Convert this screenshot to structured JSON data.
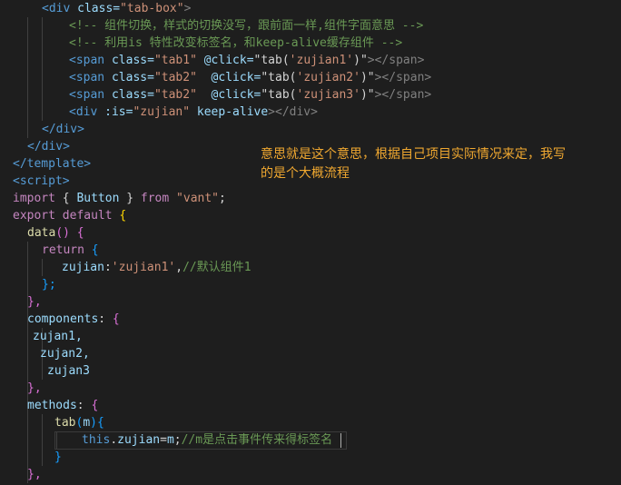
{
  "code": {
    "l1": [
      "<div ",
      "class=",
      "\"tab-box\"",
      ">"
    ],
    "l2": "<!-- 组件切换，样式的切换没写，跟前面一样,组件字面意思 -->",
    "l3": "<!-- 利用is 特性改变标签名，和keep-alive缓存组件 -->",
    "l4": [
      "<span ",
      "class=",
      "\"tab1\"",
      " @click=",
      "\"tab(",
      "'zujian1'",
      ")\"",
      "></span>"
    ],
    "l5": [
      "<span ",
      "class=",
      "\"tab2\"",
      "  @click=",
      "\"tab(",
      "'zujian2'",
      ")\"",
      "></span>"
    ],
    "l6": [
      "<span ",
      "class=",
      "\"tab2\"",
      "  @click=",
      "\"tab(",
      "'zujian3'",
      ")\"",
      "></span>"
    ],
    "l7": [
      "<div ",
      ":is=",
      "\"zujian\"",
      " keep-alive",
      "></div>"
    ],
    "l8": "</div>",
    "l9": "</div>",
    "l10": "</template>",
    "l11": "<script>",
    "l12": [
      "import",
      " { ",
      "Button",
      " } ",
      "from",
      " ",
      "\"vant\"",
      ";"
    ],
    "l13": [
      "export",
      " ",
      "default",
      " {"
    ],
    "l14": [
      "data",
      "()",
      " {"
    ],
    "l15": [
      "return",
      " {"
    ],
    "l16": [
      "zujian",
      ":",
      "'zujian1'",
      ",",
      "//默认组件1"
    ],
    "l17": "};",
    "l18": "},",
    "l19": [
      "components",
      ":",
      " {"
    ],
    "l20": "zujan1,",
    "l21": "zujan2,",
    "l22": "zujan3",
    "l23": "},",
    "l24": [
      "methods",
      ":",
      " {"
    ],
    "l25": [
      "tab",
      "(",
      "m",
      "){"
    ],
    "l26": [
      "this",
      ".",
      "zujian",
      "=",
      "m",
      ";",
      "//m是点击事件传来得标签名"
    ],
    "l27": "}",
    "l28": "},"
  },
  "annotation": {
    "line1": "意思就是这个意思，根据自己项目实际情况来定，我写",
    "line2": "的是个大概流程"
  },
  "colors": {
    "background": "#1e1e1e",
    "tag": "#569cd6",
    "attribute": "#9cdcfe",
    "string": "#ce9178",
    "comment": "#6a9955",
    "keyword": "#c586c0",
    "annotation": "#f0a830"
  }
}
